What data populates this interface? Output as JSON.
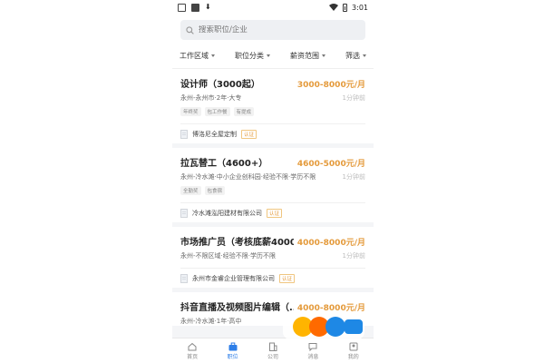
{
  "status_bar": {
    "time": "3:01"
  },
  "search": {
    "placeholder": "搜索职位/企业"
  },
  "filters": [
    {
      "label": "工作区域"
    },
    {
      "label": "职位分类"
    },
    {
      "label": "薪资范围"
    },
    {
      "label": "筛选"
    }
  ],
  "jobs": [
    {
      "title": "设计师（3000起）",
      "salary": "3000-8000元/月",
      "meta": "永州-永州市·2年·大专",
      "time": "1分钟前",
      "tags": [
        "年终奖",
        "包工作餐",
        "有提成"
      ],
      "company": "博洛尼全屋定制",
      "badge": "认证"
    },
    {
      "title": "拉瓦替工（4600+）",
      "salary": "4600-5000元/月",
      "meta": "永州-冷水滩·中小企业创科园·经验不限·学历不限",
      "time": "1分钟前",
      "tags": [
        "全勤奖",
        "包食宿"
      ],
      "company": "冷水滩泓阳建材有限公司",
      "badge": "认证"
    },
    {
      "title": "市场推广员（考核底薪4000...",
      "salary": "4000-8000元/月",
      "meta": "永州-不限区域·经验不限·学历不限",
      "time": "1分钟前",
      "company": "永州市金睿企业管理有限公司",
      "badge": "认证"
    },
    {
      "title": "抖音直播及视频图片编辑（...",
      "salary": "4000-8000元/月",
      "meta": "永州-冷水滩·1年·高中",
      "time": ""
    }
  ],
  "bottom_nav": [
    {
      "label": "首页",
      "icon": "home-icon"
    },
    {
      "label": "职位",
      "icon": "briefcase-icon"
    },
    {
      "label": "公司",
      "icon": "building-icon"
    },
    {
      "label": "消息",
      "icon": "message-icon"
    },
    {
      "label": "我的",
      "icon": "profile-icon"
    }
  ],
  "colors": {
    "accent": "#2d7ee8",
    "salary": "#e49a3b"
  }
}
